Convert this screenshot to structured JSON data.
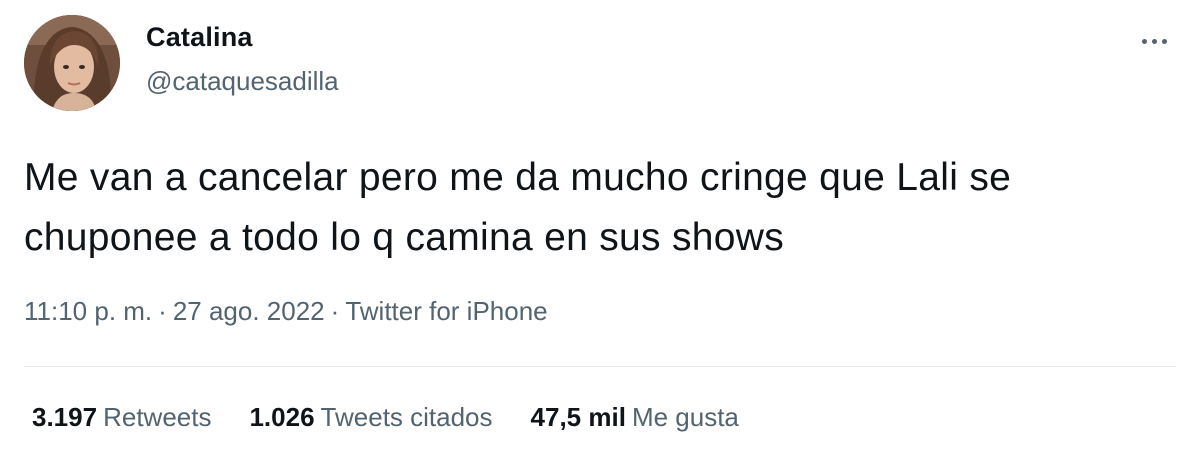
{
  "author": {
    "display_name": "Catalina",
    "handle": "@cataquesadilla",
    "avatar_icon": "profile-photo"
  },
  "menu": {
    "more_icon": "more-options-icon"
  },
  "tweet": {
    "line1": "Me van a cancelar pero me da mucho cringe que Lali se",
    "line2": "chuponee a todo lo q camina en sus shows"
  },
  "meta": {
    "time": "11:10 p. m.",
    "separator": "·",
    "date": "27 ago. 2022",
    "source": "Twitter for iPhone"
  },
  "stats": {
    "retweets": {
      "count": "3.197",
      "label": "Retweets"
    },
    "quotes": {
      "count": "1.026",
      "label": "Tweets citados"
    },
    "likes": {
      "count": "47,5 mil",
      "label": "Me gusta"
    }
  },
  "colors": {
    "text": "#0f1419",
    "secondary": "#536471",
    "divider": "#e3e8ec"
  }
}
